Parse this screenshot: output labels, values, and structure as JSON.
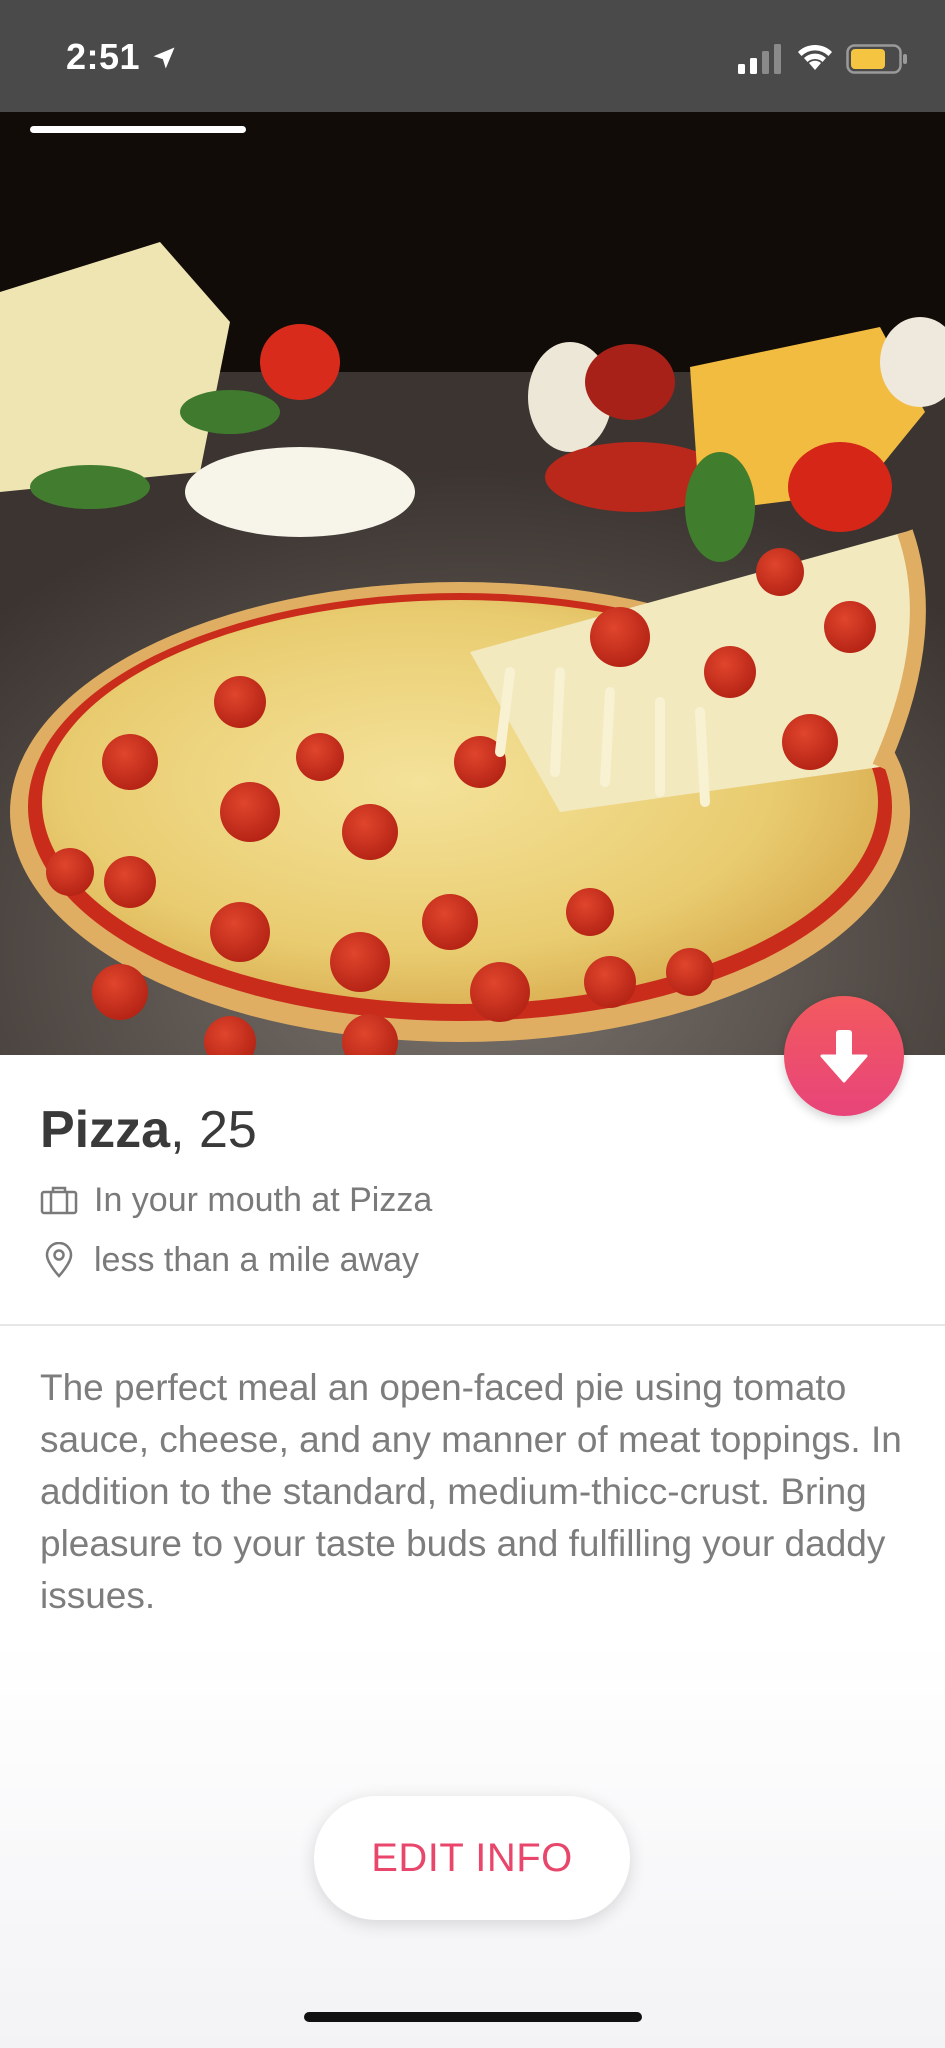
{
  "status_bar": {
    "time": "2:51",
    "icons": [
      "location-arrow-icon",
      "cellular-signal-icon",
      "wifi-icon",
      "battery-icon"
    ],
    "battery_color": "#f5c542"
  },
  "photo": {
    "description_icon": "pizza-photo",
    "photo_index": 1
  },
  "profile": {
    "name": "Pizza",
    "age_separator": ", ",
    "age": "25",
    "job": "In your mouth at Pizza",
    "distance": "less than a mile away",
    "bio": "The perfect meal an open-faced pie using tomato sauce, cheese, and any manner of meat toppings. In addition to the standard, medium-thicc-crust. Bring pleasure to your taste buds and fulfilling your daddy issues."
  },
  "actions": {
    "edit_label": "EDIT INFO",
    "collapse_icon": "arrow-down-icon"
  },
  "colors": {
    "accent": "#e8466a",
    "accent_gradient_top": "#f25a5e",
    "accent_gradient_bottom": "#e8447a",
    "status_bar_bg": "#4a4a4a"
  }
}
